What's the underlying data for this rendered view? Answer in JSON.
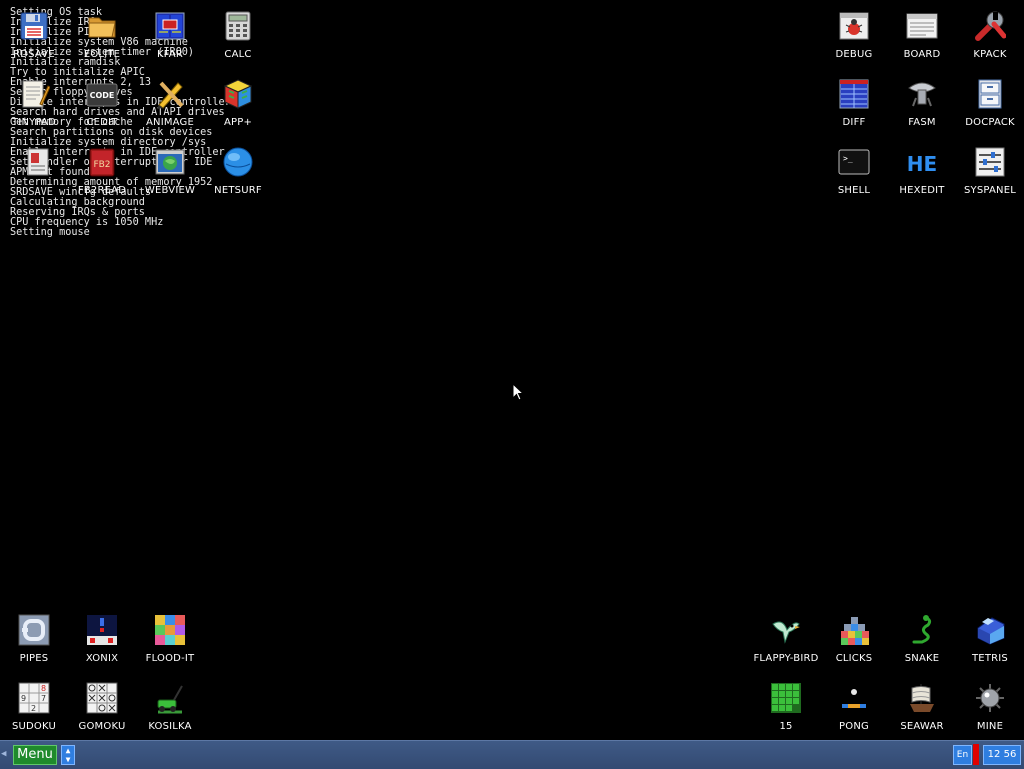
{
  "boot_log": [
    "Setting OS task",
    "Initialize IRQ",
    "Initialize PIC",
    "Initialize system V86 machine",
    "Initialize system timer (IRQ0)",
    "Initialize ramdisk",
    "Try to initialize APIC",
    "Enable interrupts 2, 13",
    "Search floppy drives",
    "Disable interrupts in IDE controller",
    "Search hard drives and ATAPI drives",
    "Get memory for cache",
    "Search partitions on disk devices",
    "Initialize system directory /sys",
    "Enable interrupts in IDE controller",
    "Set handler of interrupts for IDE",
    "APM not found",
    "Determining amount of memory 1952",
    "SRDSAVE wincfg defaults",
    "Calculating background",
    "Reserving IRQs & ports",
    "CPU frequency is 1050 MHz",
    "Setting mouse"
  ],
  "desktop_icons": {
    "rdsave": {
      "label": "RDSAVE",
      "icon": "floppy-icon"
    },
    "eolite": {
      "label": "EOLITE",
      "icon": "folder-icon"
    },
    "kfar": {
      "label": "KFAR",
      "icon": "file-manager-icon"
    },
    "calc": {
      "label": "CALC",
      "icon": "calculator-icon"
    },
    "tinypad": {
      "label": "TINYPAD",
      "icon": "notepad-icon"
    },
    "cedit": {
      "label": "CEDIT",
      "icon": "code-editor-icon",
      "badge": "CODE"
    },
    "animage": {
      "label": "ANIMAGE",
      "icon": "pencil-icon"
    },
    "appplus": {
      "label": "APP+",
      "icon": "rubik-cube-icon"
    },
    "fb2read": {
      "label": "FB2READ",
      "icon": "book-icon",
      "badge": "FB2"
    },
    "webview": {
      "label": "WEBVIEW",
      "icon": "web-browser-icon"
    },
    "netsurf": {
      "label": "NETSURF",
      "icon": "globe-icon"
    },
    "docs": {
      "label": "",
      "icon": "document-icon"
    },
    "debug": {
      "label": "DEBUG",
      "icon": "bug-icon"
    },
    "board": {
      "label": "BOARD",
      "icon": "board-window-icon"
    },
    "kpack": {
      "label": "KPACK",
      "icon": "wrench-icon"
    },
    "diff": {
      "label": "DIFF",
      "icon": "diff-icon"
    },
    "fasm": {
      "label": "FASM",
      "icon": "fasm-icon"
    },
    "docpack": {
      "label": "DOCPACK",
      "icon": "cabinet-icon"
    },
    "shell": {
      "label": "SHELL",
      "icon": "terminal-icon",
      "prompt": ">_"
    },
    "hexedit": {
      "label": "HEXEDIT",
      "icon": "hex-editor-icon",
      "badge": "HE"
    },
    "syspanel": {
      "label": "SYSPANEL",
      "icon": "sliders-icon"
    },
    "pipes": {
      "label": "PIPES",
      "icon": "pipes-icon"
    },
    "xonix": {
      "label": "XONIX",
      "icon": "xonix-icon"
    },
    "floodit": {
      "label": "FLOOD-IT",
      "icon": "color-grid-icon"
    },
    "sudoku": {
      "label": "SUDOKU",
      "icon": "sudoku-icon",
      "digits": [
        "9",
        "7",
        "2",
        "8"
      ]
    },
    "gomoku": {
      "label": "GOMOKU",
      "icon": "tic-tac-toe-icon"
    },
    "kosilka": {
      "label": "KOSILKA",
      "icon": "lawn-mower-icon"
    },
    "flappybird": {
      "label": "FLAPPY-BIRD",
      "icon": "bird-icon"
    },
    "clicks": {
      "label": "CLICKS",
      "icon": "blocks-icon"
    },
    "snake": {
      "label": "SNAKE",
      "icon": "snake-icon"
    },
    "tetris": {
      "label": "TETRIS",
      "icon": "tetris-icon"
    },
    "fifteen": {
      "label": "15",
      "icon": "puzzle-15-icon"
    },
    "pong": {
      "label": "PONG",
      "icon": "pong-icon"
    },
    "seawar": {
      "label": "SEAWAR",
      "icon": "ship-icon"
    },
    "mine": {
      "label": "MINE",
      "icon": "mine-icon"
    }
  },
  "taskbar": {
    "menu_label": "Menu",
    "language": "En",
    "clock": "12 56"
  },
  "colors": {
    "desktop": "#000000",
    "taskbar": "#3a5380",
    "menu_button": "#1f8a2c",
    "indicator_blue": "#2f7ee0",
    "indicator_red": "#e00000"
  }
}
